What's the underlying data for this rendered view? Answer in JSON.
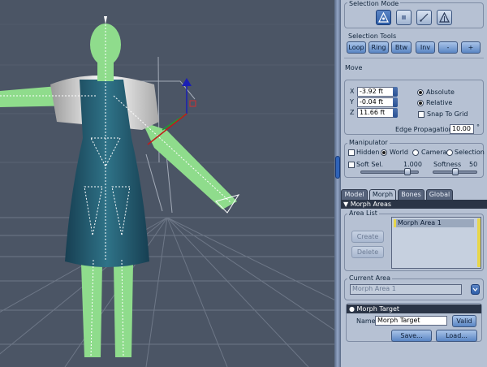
{
  "panel": {
    "selection_mode": {
      "title": "Selection Mode",
      "buttons": [
        "vertex-select-icon",
        "face-select-icon",
        "edge-select-icon",
        "lasso-select-icon"
      ]
    },
    "selection_tools": {
      "title": "Selection Tools",
      "buttons": [
        "Loop",
        "Ring",
        "Btw",
        "Inv",
        "-",
        "+"
      ]
    },
    "move": {
      "title": "Move",
      "x_label": "X",
      "x_value": "-3.92 ft",
      "y_label": "Y",
      "y_value": "-0.04 ft",
      "z_label": "Z",
      "z_value": "11.66 ft",
      "absolute": "Absolute",
      "relative": "Relative",
      "snap": "Snap To Grid",
      "edge_label": "Edge Propagation",
      "edge_value": "10.00",
      "degree": "°"
    },
    "manipulator": {
      "title": "Manipulator",
      "hidden": "Hidden",
      "world": "World",
      "camera": "Camera",
      "selection": "Selection",
      "soft_sel": "Soft Sel.",
      "soft_sel_value": "1.000",
      "softness": "Softness",
      "softness_value": "50",
      "soft_sel_level": 0.85,
      "softness_level": 0.5
    },
    "tabs": [
      "Model",
      "Morph",
      "Bones",
      "Global"
    ],
    "active_tab": "Morph",
    "morph_areas": {
      "header": "▼ Morph Areas",
      "area_list_label": "Area List",
      "create": "Create",
      "delete": "Delete",
      "items": [
        "Morph Area 1"
      ],
      "current_area_label": "Current Area",
      "current_area_value": "Morph Area 1"
    },
    "morph_target": {
      "header": "● Morph Target",
      "name_label": "Name:",
      "name_value": "Morph Target",
      "valid": "Valid",
      "save": "Save...",
      "load": "Load..."
    }
  },
  "colors": {
    "accent": "#2e5ea8",
    "mesh_green": "#8fdc8c",
    "dress": "#1f5a6e",
    "viewport_bg": "#4b5565"
  }
}
